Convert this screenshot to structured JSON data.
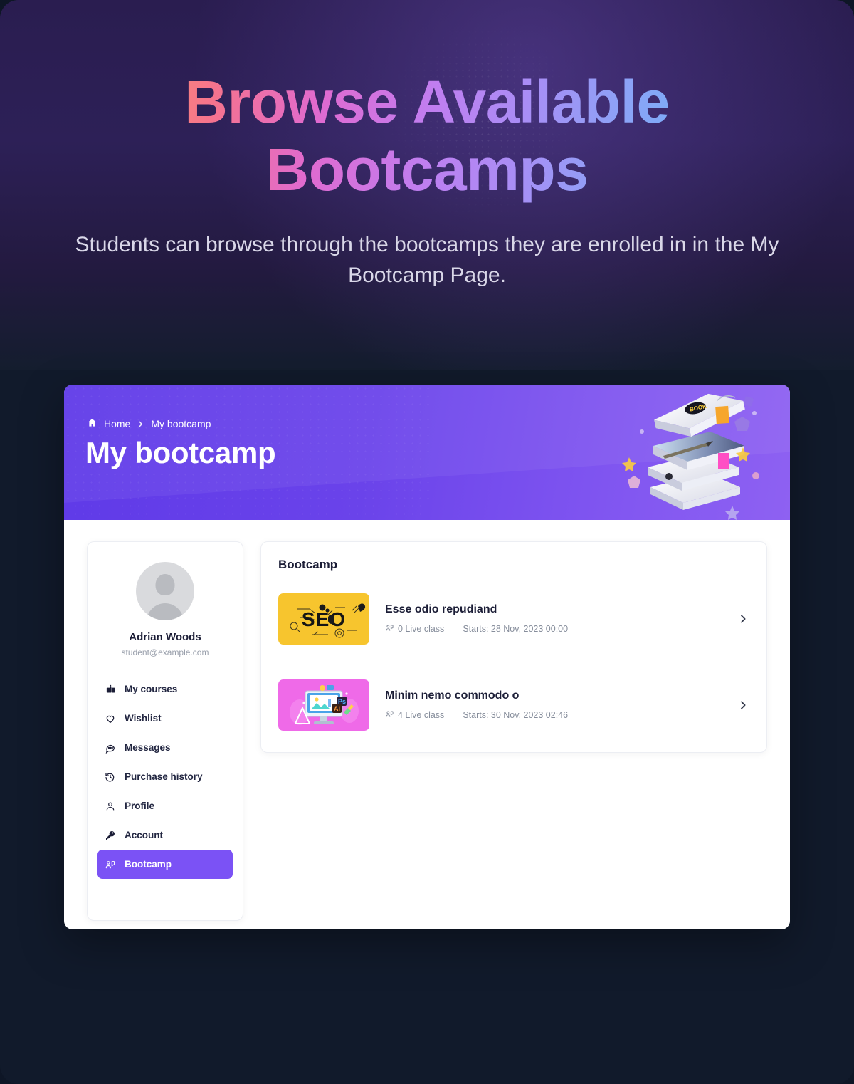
{
  "hero": {
    "title": "Browse Available Bootcamps",
    "subtitle": "Students can browse through the bootcamps they are enrolled in in the My Bootcamp Page.",
    "gradient_start": "#ff9a62",
    "gradient_end": "#63b9f7"
  },
  "app": {
    "accent": "#7b52f5",
    "header_gradient_start": "#5f3ae8",
    "header_gradient_end": "#8e61f2",
    "breadcrumb": {
      "home_label": "Home",
      "separator": "›",
      "current_label": "My bootcamp"
    },
    "page_title": "My bootcamp",
    "illustration": "stack-of-books-illustration"
  },
  "sidebar": {
    "avatar": "default-user-avatar",
    "user_name": "Adrian Woods",
    "user_email": "student@example.com",
    "items": [
      {
        "label": "My courses",
        "icon": "courses-icon",
        "active": false
      },
      {
        "label": "Wishlist",
        "icon": "heart-icon",
        "active": false
      },
      {
        "label": "Messages",
        "icon": "chat-icon",
        "active": false
      },
      {
        "label": "Purchase history",
        "icon": "history-icon",
        "active": false
      },
      {
        "label": "Profile",
        "icon": "user-icon",
        "active": false
      },
      {
        "label": "Account",
        "icon": "key-icon",
        "active": false
      },
      {
        "label": "Bootcamp",
        "icon": "bootcamp-icon",
        "active": true
      }
    ]
  },
  "main": {
    "section_title": "Bootcamp",
    "bootcamps": [
      {
        "title": "Esse odio repudiand",
        "live_class": "0 Live class",
        "starts": "Starts: 28 Nov, 2023 00:00",
        "thumb": "seo-thumbnail",
        "thumb_color": "#f7c52e",
        "chevron": "chevron-right-icon"
      },
      {
        "title": "Minim nemo commodo o",
        "live_class": "4 Live class",
        "starts": "Starts: 30 Nov, 2023 02:46",
        "thumb": "graphic-design-thumbnail",
        "thumb_color": "#ef6ae8",
        "chevron": "chevron-right-icon"
      }
    ]
  }
}
